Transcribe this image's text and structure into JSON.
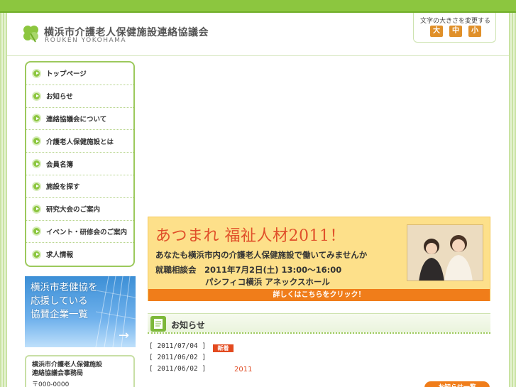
{
  "header": {
    "title": "横浜市介護老人保健施設連絡協議会",
    "subtitle": "ROUKEN YOKOHAMA",
    "font_size_label": "文字の大きさを変更する",
    "font_size_buttons": [
      "大",
      "中",
      "小"
    ]
  },
  "nav": {
    "items": [
      {
        "label": "トップページ"
      },
      {
        "label": "お知らせ"
      },
      {
        "label": "連絡協議会について"
      },
      {
        "label": "介護老人保健施設とは"
      },
      {
        "label": "会員名簿"
      },
      {
        "label": "施設を探す"
      },
      {
        "label": "研究大会のご案内"
      },
      {
        "label": "イベント・研修会のご案内"
      },
      {
        "label": "求人情報"
      }
    ]
  },
  "sponsor": {
    "text": "横浜市老健協を\n応援している\n協賛企業一覧",
    "arrow": "→"
  },
  "office": {
    "line1": "横浜市介護老人保健施設",
    "line2": "連絡協議会事務局",
    "line3": "〒000-0000"
  },
  "banner": {
    "title": "あつまれ  福祉人材2011！",
    "lead": "あなたも横浜市内の介護老人保健施設で働いてみませんか",
    "event": "就職相談会　2011年7月2日(土) 13:00〜16:00",
    "venue": "パシフィコ横浜  アネックスホール",
    "cta": "詳しくはこちらをクリック！"
  },
  "news": {
    "heading": "お知らせ",
    "rows": [
      {
        "date": "[ 2011/07/04 ]",
        "badge": "新着",
        "text": ""
      },
      {
        "date": "[ 2011/06/02 ]",
        "badge": "",
        "text": ""
      },
      {
        "date": "[ 2011/06/02 ]",
        "badge": "",
        "text": "2011"
      }
    ],
    "more": "お知らせ一覧"
  },
  "colors": {
    "brand_green": "#8cc63f",
    "accent_orange": "#f07d1a",
    "banner_yellow": "#fde08a"
  }
}
